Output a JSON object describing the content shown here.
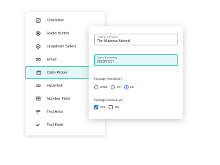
{
  "field_types": [
    {
      "icon": "checkbox-icon",
      "label": "Checkbox"
    },
    {
      "icon": "radio-button-icon",
      "label": "Radio Button"
    },
    {
      "icon": "dropdown-select-icon",
      "label": "Dropdown Select"
    },
    {
      "icon": "email-icon",
      "label": "Email"
    },
    {
      "icon": "calendar-icon",
      "label": "Date Picker",
      "selected": true
    },
    {
      "icon": "link-icon",
      "label": "Hyperlink"
    },
    {
      "icon": "number-field-icon",
      "label": "Number Field"
    },
    {
      "icon": "text-area-icon",
      "label": "Text Area"
    },
    {
      "icon": "text-field-icon",
      "label": "Text Field"
    }
  ],
  "form": {
    "project": {
      "label": "* Name of Project",
      "value": "The Mutinous Admiral"
    },
    "recording_date": {
      "label": "Day of Recording",
      "value": "2023/07/17"
    },
    "resolution": {
      "label": "Footage Resolution",
      "options": [
        "1080",
        "4K",
        "6K"
      ],
      "selected": "6K"
    },
    "backed_up": {
      "label": "Footage backed up?",
      "options": [
        "Yes",
        "No"
      ],
      "checked": [
        "Yes"
      ]
    }
  },
  "colors": {
    "accent": "#33c7c9",
    "accent_fill": "#e4f7f8",
    "control_blue": "#1a73e8"
  }
}
